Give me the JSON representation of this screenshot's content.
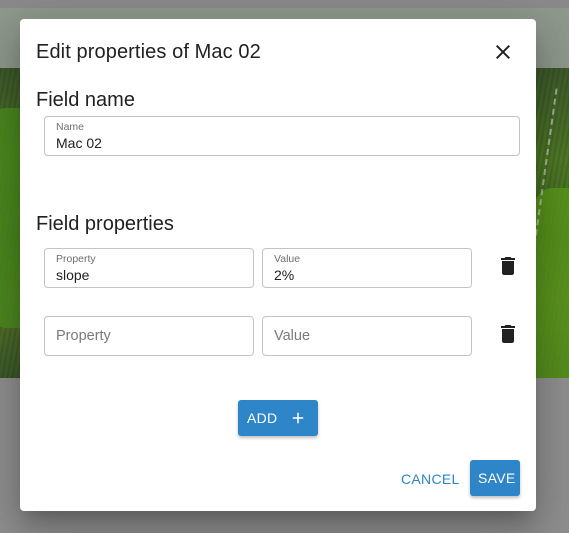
{
  "dialog": {
    "title": "Edit properties of Mac 02",
    "close_icon": "close-icon"
  },
  "field_name": {
    "heading": "Field name",
    "name_label": "Name",
    "name_value": "Mac 02"
  },
  "field_properties": {
    "heading": "Field properties",
    "rows": [
      {
        "property_label": "Property",
        "property_value": "slope",
        "value_label": "Value",
        "value_value": "2%"
      },
      {
        "property_placeholder": "Property",
        "value_placeholder": "Value"
      }
    ],
    "delete_icon": "trash-icon"
  },
  "actions": {
    "add_label": "ADD",
    "add_icon": "plus-icon",
    "cancel_label": "CANCEL",
    "save_label": "SAVE"
  },
  "colors": {
    "primary": "#2e86c8",
    "text": "#212121",
    "border": "#c4c4c4"
  }
}
